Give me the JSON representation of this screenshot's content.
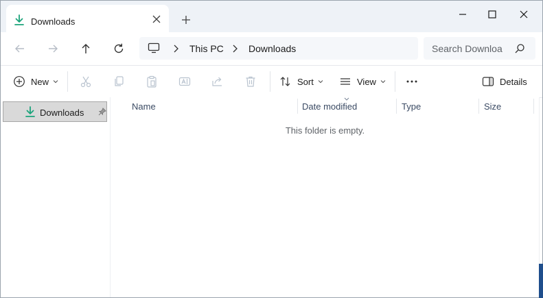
{
  "tab": {
    "title": "Downloads",
    "icon": "download-icon"
  },
  "address": {
    "segments": [
      "This PC",
      "Downloads"
    ],
    "root_icon": "monitor-icon"
  },
  "search": {
    "placeholder": "Search Downloa"
  },
  "commands": {
    "new_label": "New",
    "sort_label": "Sort",
    "view_label": "View",
    "details_label": "Details"
  },
  "nav_pane": {
    "items": [
      {
        "label": "Downloads",
        "icon": "download-icon",
        "pinned": true
      }
    ]
  },
  "columns": [
    "Name",
    "Date modified",
    "Type",
    "Size"
  ],
  "content": {
    "empty_message": "This folder is empty."
  },
  "colors": {
    "accent": "#1aa37a",
    "selected_bg": "#d9d9d9",
    "icon_gray": "#404040",
    "disabled": "#b9c3cf"
  }
}
